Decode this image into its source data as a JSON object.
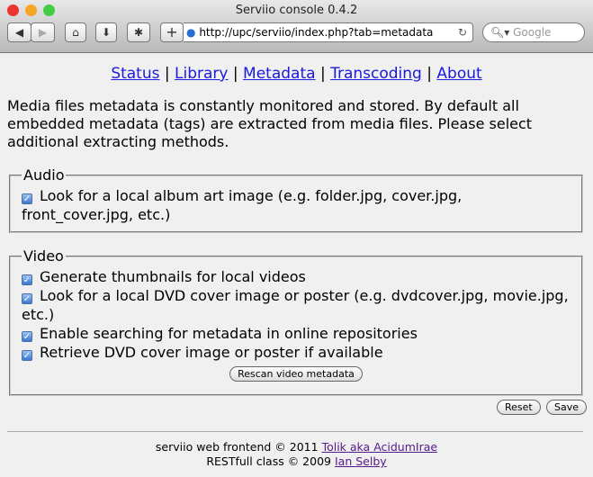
{
  "window": {
    "title": "Serviio console 0.4.2",
    "url": "http://upc/serviio/index.php?tab=metadata",
    "search_placeholder": "Google"
  },
  "nav": [
    "Status",
    "Library",
    "Metadata",
    "Transcoding",
    "About"
  ],
  "intro": "Media files metadata is constantly monitored and stored. By default all embedded metadata (tags) are extracted from media files. Please select additional extracting methods.",
  "audio": {
    "legend": "Audio",
    "options": [
      {
        "label": "Look for a local album art image (e.g. folder.jpg, cover.jpg, front_cover.jpg, etc.)",
        "checked": true
      }
    ]
  },
  "video": {
    "legend": "Video",
    "options": [
      {
        "label": "Generate thumbnails for local videos",
        "checked": true
      },
      {
        "label": "Look for a local DVD cover image or poster (e.g. dvdcover.jpg, movie.jpg, etc.)",
        "checked": true
      },
      {
        "label": "Enable searching for metadata in online repositories",
        "checked": true
      },
      {
        "label": "Retrieve DVD cover image or poster if available",
        "checked": true
      }
    ],
    "rescan_label": "Rescan video metadata"
  },
  "buttons": {
    "reset": "Reset",
    "save": "Save"
  },
  "footer": {
    "line1": "serviio web frontend © 2011",
    "link1": "Tolik aka AcidumIrae",
    "line2": "RESTfull class © 2009",
    "link2": "Ian Selby"
  }
}
